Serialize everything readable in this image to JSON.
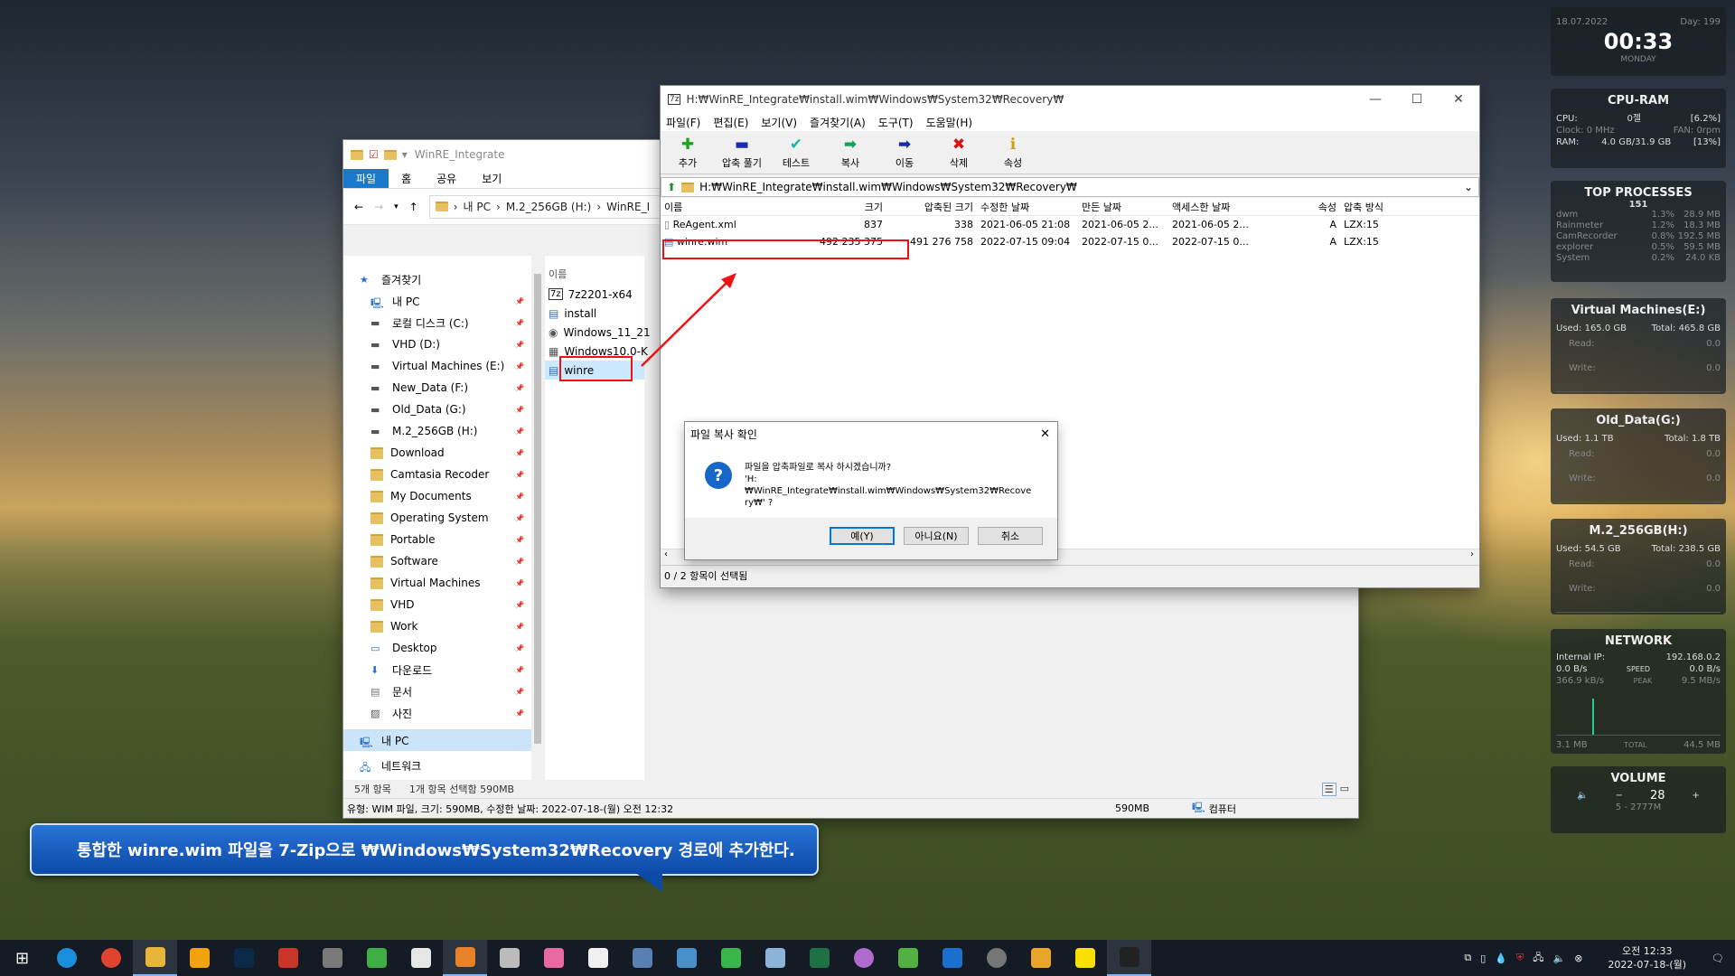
{
  "explorer": {
    "title": "WinRE_Integrate",
    "ribbon_tabs": [
      "파일",
      "홈",
      "공유",
      "보기"
    ],
    "breadcrumb": [
      "내 PC",
      "M.2_256GB (H:)",
      "WinRE_I"
    ],
    "tree": [
      {
        "label": "즐겨찾기",
        "icon": "star-icon"
      },
      {
        "label": "내 PC",
        "icon": "pc-icon"
      },
      {
        "label": "로컬 디스크 (C:)",
        "icon": "drive-icon"
      },
      {
        "label": "VHD (D:)",
        "icon": "drive-icon"
      },
      {
        "label": "Virtual Machines (E:)",
        "icon": "drive-icon"
      },
      {
        "label": "New_Data (F:)",
        "icon": "drive-icon"
      },
      {
        "label": "Old_Data (G:)",
        "icon": "drive-icon"
      },
      {
        "label": "M.2_256GB (H:)",
        "icon": "drive-icon"
      },
      {
        "label": "Download",
        "icon": "folder-icon"
      },
      {
        "label": "Camtasia Recoder",
        "icon": "folder-icon"
      },
      {
        "label": "My Documents",
        "icon": "folder-icon"
      },
      {
        "label": "Operating System",
        "icon": "folder-icon"
      },
      {
        "label": "Portable",
        "icon": "folder-icon"
      },
      {
        "label": "Software",
        "icon": "folder-icon"
      },
      {
        "label": "Virtual Machines",
        "icon": "folder-icon"
      },
      {
        "label": "VHD",
        "icon": "folder-icon"
      },
      {
        "label": "Work",
        "icon": "folder-icon"
      },
      {
        "label": "Desktop",
        "icon": "desktop-icon"
      },
      {
        "label": "다운로드",
        "icon": "download-icon"
      },
      {
        "label": "문서",
        "icon": "document-icon"
      },
      {
        "label": "사진",
        "icon": "picture-icon"
      },
      {
        "label": "내 PC",
        "icon": "pc-icon"
      },
      {
        "label": "네트워크",
        "icon": "network-icon"
      }
    ],
    "content_header": "이름",
    "files": [
      "7z2201-x64",
      "install",
      "Windows_11_21",
      "Windows10.0-K",
      "winre"
    ],
    "status_count": "5개 항목",
    "status_selected": "1개 항목 선택함 590MB",
    "detail": "유형: WIM 파일, 크기: 590MB, 수정한 날짜: 2022-07-18-(월) 오전 12:32",
    "detail_size": "590MB",
    "detail_location": "컴퓨터"
  },
  "zip": {
    "title": "H:₩WinRE_Integrate₩install.wim₩Windows₩System32₩Recovery₩",
    "menu": [
      "파일(F)",
      "편집(E)",
      "보기(V)",
      "즐겨찾기(A)",
      "도구(T)",
      "도움말(H)"
    ],
    "toolbar": [
      {
        "label": "추가",
        "icon": "add-icon",
        "glyph": "✚",
        "color": "#1fa31f"
      },
      {
        "label": "압축 풀기",
        "icon": "extract-icon",
        "glyph": "▬",
        "color": "#1b2bb8"
      },
      {
        "label": "테스트",
        "icon": "test-icon",
        "glyph": "✔",
        "color": "#19b6b0"
      },
      {
        "label": "복사",
        "icon": "copy-icon",
        "glyph": "➡",
        "color": "#14a05a"
      },
      {
        "label": "이동",
        "icon": "move-icon",
        "glyph": "➡",
        "color": "#1a2aa8"
      },
      {
        "label": "삭제",
        "icon": "delete-icon",
        "glyph": "✖",
        "color": "#d01616"
      },
      {
        "label": "속성",
        "icon": "info-icon",
        "glyph": "ℹ",
        "color": "#c9a20d"
      }
    ],
    "path": "H:₩WinRE_Integrate₩install.wim₩Windows₩System32₩Recovery₩",
    "columns": [
      "이름",
      "크기",
      "압축된 크기",
      "수정한 날짜",
      "만든 날짜",
      "액세스한 날짜",
      "속성",
      "압축 방식"
    ],
    "rows": [
      [
        "ReAgent.xml",
        "837",
        "338",
        "2021-06-05 21:08",
        "2021-06-05 2...",
        "2021-06-05 2...",
        "A",
        "LZX:15"
      ],
      [
        "winre.wim",
        "492 235 375",
        "491 276 758",
        "2022-07-15 09:04",
        "2022-07-15 0...",
        "2022-07-15 0...",
        "A",
        "LZX:15"
      ]
    ],
    "status": "0 / 2 항목이 선택됨"
  },
  "dialog": {
    "title": "파일 복사 확인",
    "line1": "파일을 압축파일로 복사 하시겠습니까?",
    "line2": "'H:₩WinRE_Integrate₩install.wim₩Windows₩System32₩Recove",
    "line3": "ry₩' ?",
    "yes": "예(Y)",
    "no": "아니요(N)",
    "cancel": "취소"
  },
  "caption": "통합한 winre.wim 파일을 7-Zip으로 ₩Windows₩System32₩Recovery 경로에 추가한다.",
  "widgets": {
    "clock": {
      "date": "18.07.2022",
      "day": "Day: 199",
      "time": "00:33",
      "weekday": "MONDAY"
    },
    "cpuram": {
      "title": "CPU-RAM",
      "cpu_label": "CPU:",
      "cpu_mid": "0젤",
      "cpu_val": "[6.2%]",
      "clock": "Clock: 0 MHz",
      "fan": "FAN: 0rpm",
      "ram_label": "RAM:",
      "ram_mid": "4.0 GB/31.9 GB",
      "ram_val": "[13%]"
    },
    "top": {
      "title": "TOP PROCESSES",
      "count": "151",
      "rows": [
        [
          "dwm",
          "1.3%",
          "28.9 MB"
        ],
        [
          "Rainmeter",
          "1.2%",
          "18.3 MB"
        ],
        [
          "CamRecorder",
          "0.8%",
          "192.5 MB"
        ],
        [
          "explorer",
          "0.5%",
          "59.5 MB"
        ],
        [
          "System",
          "0.2%",
          "24.0 KB"
        ]
      ]
    },
    "drives": [
      {
        "title": "Virtual Machines(E:)",
        "used": "Used: 165.0 GB",
        "total": "Total: 465.8 GB",
        "read": "Read:",
        "write": "Write:",
        "rv": "0.0",
        "wv": "0.0"
      },
      {
        "title": "Old_Data(G:)",
        "used": "Used: 1.1 TB",
        "total": "Total: 1.8 TB",
        "read": "Read:",
        "write": "Write:",
        "rv": "0.0",
        "wv": "0.0"
      },
      {
        "title": "M.2_256GB(H:)",
        "used": "Used: 54.5 GB",
        "total": "Total: 238.5 GB",
        "read": "Read:",
        "write": "Write:",
        "rv": "0.0",
        "wv": "0.0"
      }
    ],
    "network": {
      "title": "NETWORK",
      "ip_label": "Internal IP:",
      "ip": "192.168.0.2",
      "up": "0.0 B/s",
      "speed": "SPEED",
      "up2": "0.0 B/s",
      "down": "366.9 kB/s",
      "peak": "PEAK",
      "down2": "9.5 MB/s",
      "tot1": "3.1 MB",
      "total": "TOTAL",
      "tot2": "44.5 MB"
    },
    "volume": {
      "title": "VOLUME",
      "value": "28",
      "range": "5 - 2777M"
    }
  },
  "taskbar": {
    "apps": [
      {
        "icon": "edge-icon",
        "color": "#1c8fdc"
      },
      {
        "icon": "chrome-icon",
        "color": "#e0432f"
      },
      {
        "icon": "file-explorer-icon",
        "color": "#e8b53b"
      },
      {
        "icon": "app-a-icon",
        "color": "#f2a20c"
      },
      {
        "icon": "photoshop-icon",
        "color": "#0b2a4a"
      },
      {
        "icon": "app-red-icon",
        "color": "#c8362a"
      },
      {
        "icon": "app-tools-icon",
        "color": "#7a7a7a"
      },
      {
        "icon": "app-c-icon",
        "color": "#3fae43"
      },
      {
        "icon": "app-c2-icon",
        "color": "#e6e6e6"
      },
      {
        "icon": "app-orange-icon",
        "color": "#e8822a"
      },
      {
        "icon": "app-box-icon",
        "color": "#bbbbbb"
      },
      {
        "icon": "app-pink-icon",
        "color": "#e86aa0"
      },
      {
        "icon": "app-d-icon",
        "color": "#f0f0f0"
      },
      {
        "icon": "app-people-icon",
        "color": "#5a7fb3"
      },
      {
        "icon": "app-fish-icon",
        "color": "#4a90c8"
      },
      {
        "icon": "app-diamond-icon",
        "color": "#39b54a"
      },
      {
        "icon": "app-gear-icon",
        "color": "#8ab4d8"
      },
      {
        "icon": "excel-icon",
        "color": "#1e7145"
      },
      {
        "icon": "app-circle-icon",
        "color": "#b06ad0"
      },
      {
        "icon": "app-leaf-icon",
        "color": "#55b044"
      },
      {
        "icon": "app-blue-icon",
        "color": "#1a6fcf"
      },
      {
        "icon": "app-circle2-icon",
        "color": "#777777"
      },
      {
        "icon": "app-windows-icon",
        "color": "#e8a52a"
      },
      {
        "icon": "talk-icon",
        "color": "#f9e000"
      },
      {
        "icon": "7zip-icon",
        "color": "#222222"
      }
    ],
    "time": "오전 12:33",
    "date": "2022-07-18-(월)"
  }
}
